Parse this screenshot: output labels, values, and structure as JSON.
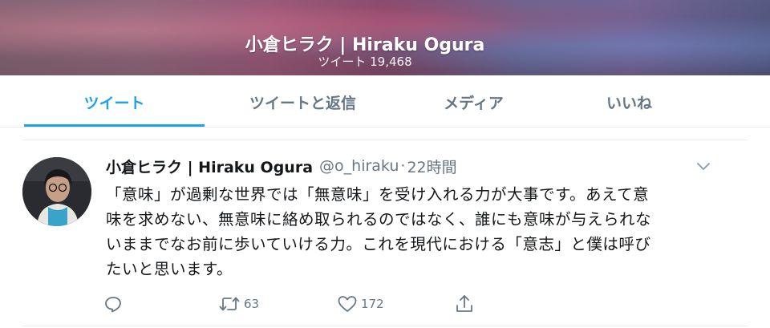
{
  "profile_header": {
    "title": "小倉ヒラク | Hiraku Ogura",
    "tweet_count": "ツイート 19,468"
  },
  "tabs": [
    {
      "label": "ツイート",
      "active": true
    },
    {
      "label": "ツイートと返信",
      "active": false
    },
    {
      "label": "メディア",
      "active": false
    },
    {
      "label": "いいね",
      "active": false
    }
  ],
  "tweet": {
    "author_name": "小倉ヒラク | Hiraku Ogura",
    "handle": "@o_hiraku",
    "separator": "·",
    "time": "22時間",
    "text_lines": [
      "「意味」が過剰な世界では「無意味」を受け入れる力が大事です。あえて意",
      "味を求めない、無意味に絡め取られるのではなく、誰にも意味が与えられな",
      "いままでなお前に歩いていける力。これを現代における「意志」と僕は呼び",
      "たいと思います。"
    ],
    "actions": {
      "reply": {
        "icon": "reply-icon",
        "count": ""
      },
      "retweet": {
        "icon": "retweet-icon",
        "count": "63"
      },
      "like": {
        "icon": "heart-icon",
        "count": "172"
      },
      "share": {
        "icon": "share-icon",
        "count": ""
      }
    }
  },
  "colors": {
    "accent": "#1da1f2",
    "secondary_text": "#657786",
    "primary_text": "#14171a"
  }
}
